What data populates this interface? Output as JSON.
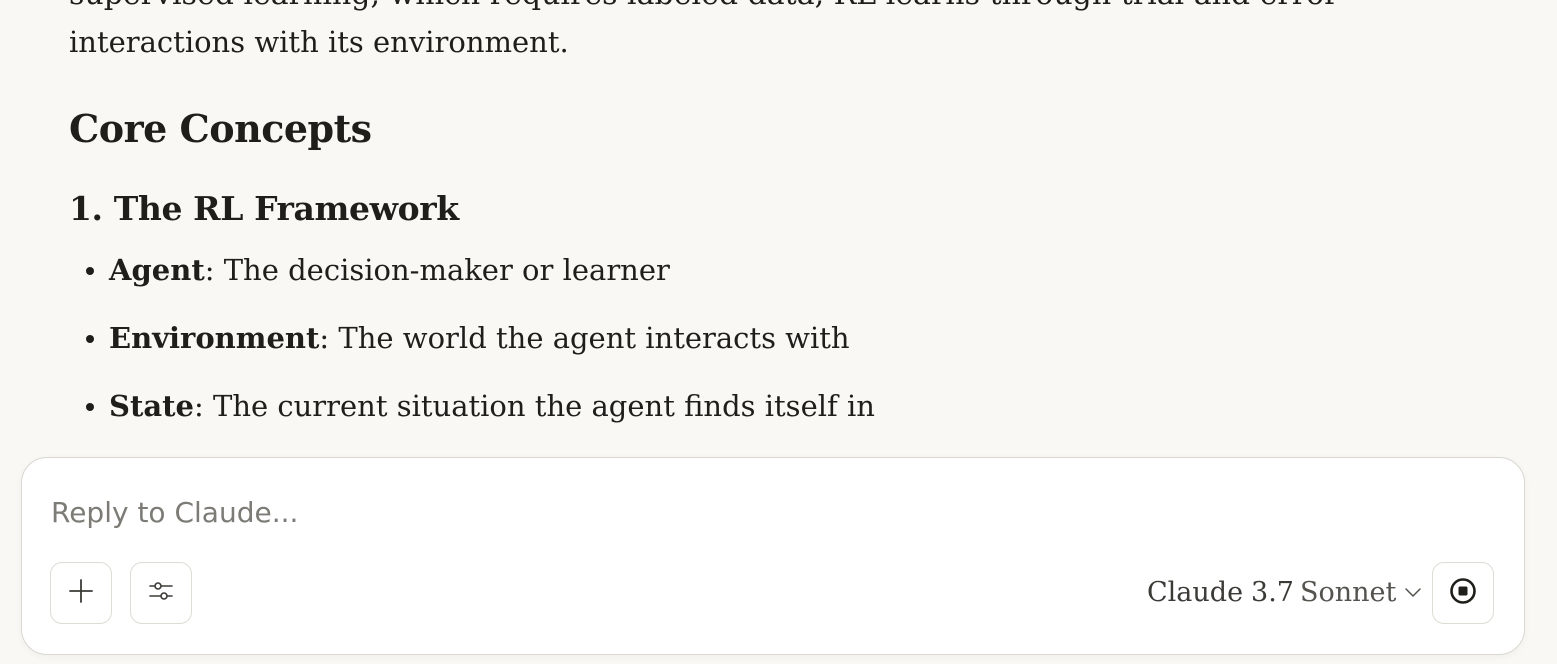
{
  "message": {
    "partial_line": "supervised learning, which requires labeled data, RL learns through trial and error",
    "last_line": "interactions with its environment.",
    "heading": "Core Concepts",
    "subheading": "1. The RL Framework",
    "bullets": [
      {
        "term": "Agent",
        "desc": ": The decision-maker or learner"
      },
      {
        "term": "Environment",
        "desc": ": The world the agent interacts with"
      },
      {
        "term": "State",
        "desc": ": The current situation the agent finds itself in"
      }
    ]
  },
  "composer": {
    "placeholder": "Reply to Claude...",
    "value": "",
    "model_name": "Claude",
    "model_version": "3.7",
    "model_variant": "Sonnet",
    "icons": {
      "add": "plus-icon",
      "tools": "sliders-icon",
      "dropdown": "chevron-down-icon",
      "stop": "stop-icon"
    }
  },
  "colors": {
    "background": "#f9f8f5",
    "text": "#1f1e1b",
    "composer_bg": "#ffffff",
    "border": "#d9d7d0",
    "placeholder": "#7d7b75"
  }
}
